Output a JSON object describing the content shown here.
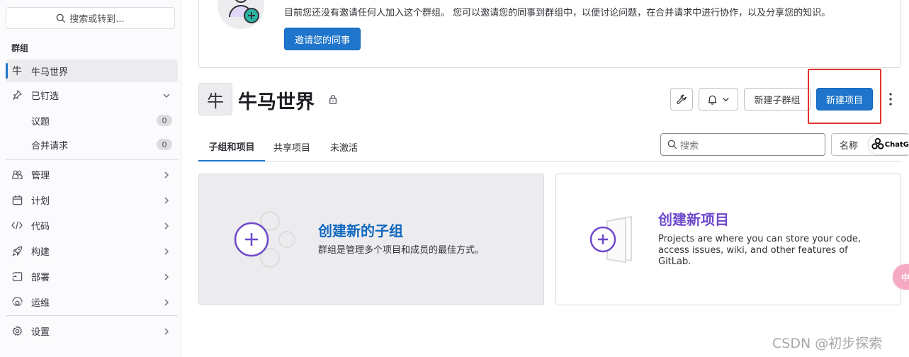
{
  "sidebar": {
    "search_placeholder": "搜索或转到...",
    "section_label": "群组",
    "group_item": {
      "avatar_letter": "牛",
      "label": "牛马世界"
    },
    "pinned": {
      "label": "已钉选"
    },
    "pinned_items": [
      {
        "label": "议题",
        "count": "0"
      },
      {
        "label": "合并请求",
        "count": "0"
      }
    ],
    "nav": [
      {
        "label": "管理",
        "icon": "users-icon"
      },
      {
        "label": "计划",
        "icon": "calendar-icon"
      },
      {
        "label": "代码",
        "icon": "code-icon"
      },
      {
        "label": "构建",
        "icon": "rocket-icon"
      },
      {
        "label": "部署",
        "icon": "deploy-icon"
      },
      {
        "label": "运维",
        "icon": "monitor-icon"
      }
    ],
    "settings": {
      "label": "设置",
      "icon": "gear-icon"
    }
  },
  "invite": {
    "text": "目前您还没有邀请任何人加入这个群组。 您可以邀请您的同事到群组中，以便讨论问题，在合并请求中进行协作，以及分享您的知识。",
    "button": "邀请您的同事"
  },
  "group": {
    "avatar_letter": "牛",
    "title": "牛马世界"
  },
  "actions": {
    "new_subgroup": "新建子群组",
    "new_project": "新建项目"
  },
  "tabs": [
    {
      "label": "子组和项目",
      "active": true
    },
    {
      "label": "共享项目",
      "active": false
    },
    {
      "label": "未激活",
      "active": false
    }
  ],
  "filter": {
    "search_placeholder": "搜索",
    "sort_label": "名称"
  },
  "cards": {
    "subgroup": {
      "title": "创建新的子组",
      "desc": "群组是管理多个项目和成员的最佳方式。"
    },
    "project": {
      "title": "创建新项目",
      "desc": "Projects are where you can store your code, access issues, wiki, and other features of GitLab."
    }
  },
  "overlays": {
    "chatgpt_badge": "ChatG",
    "pink_bubble": "中",
    "watermark": "CSDN @初步探索"
  },
  "colors": {
    "primary": "#1f75cb",
    "highlight": "#e3322b",
    "subgroup_title": "#1068bf",
    "project_title": "#6e49cb",
    "sidebar_bg": "#fbfafd"
  }
}
